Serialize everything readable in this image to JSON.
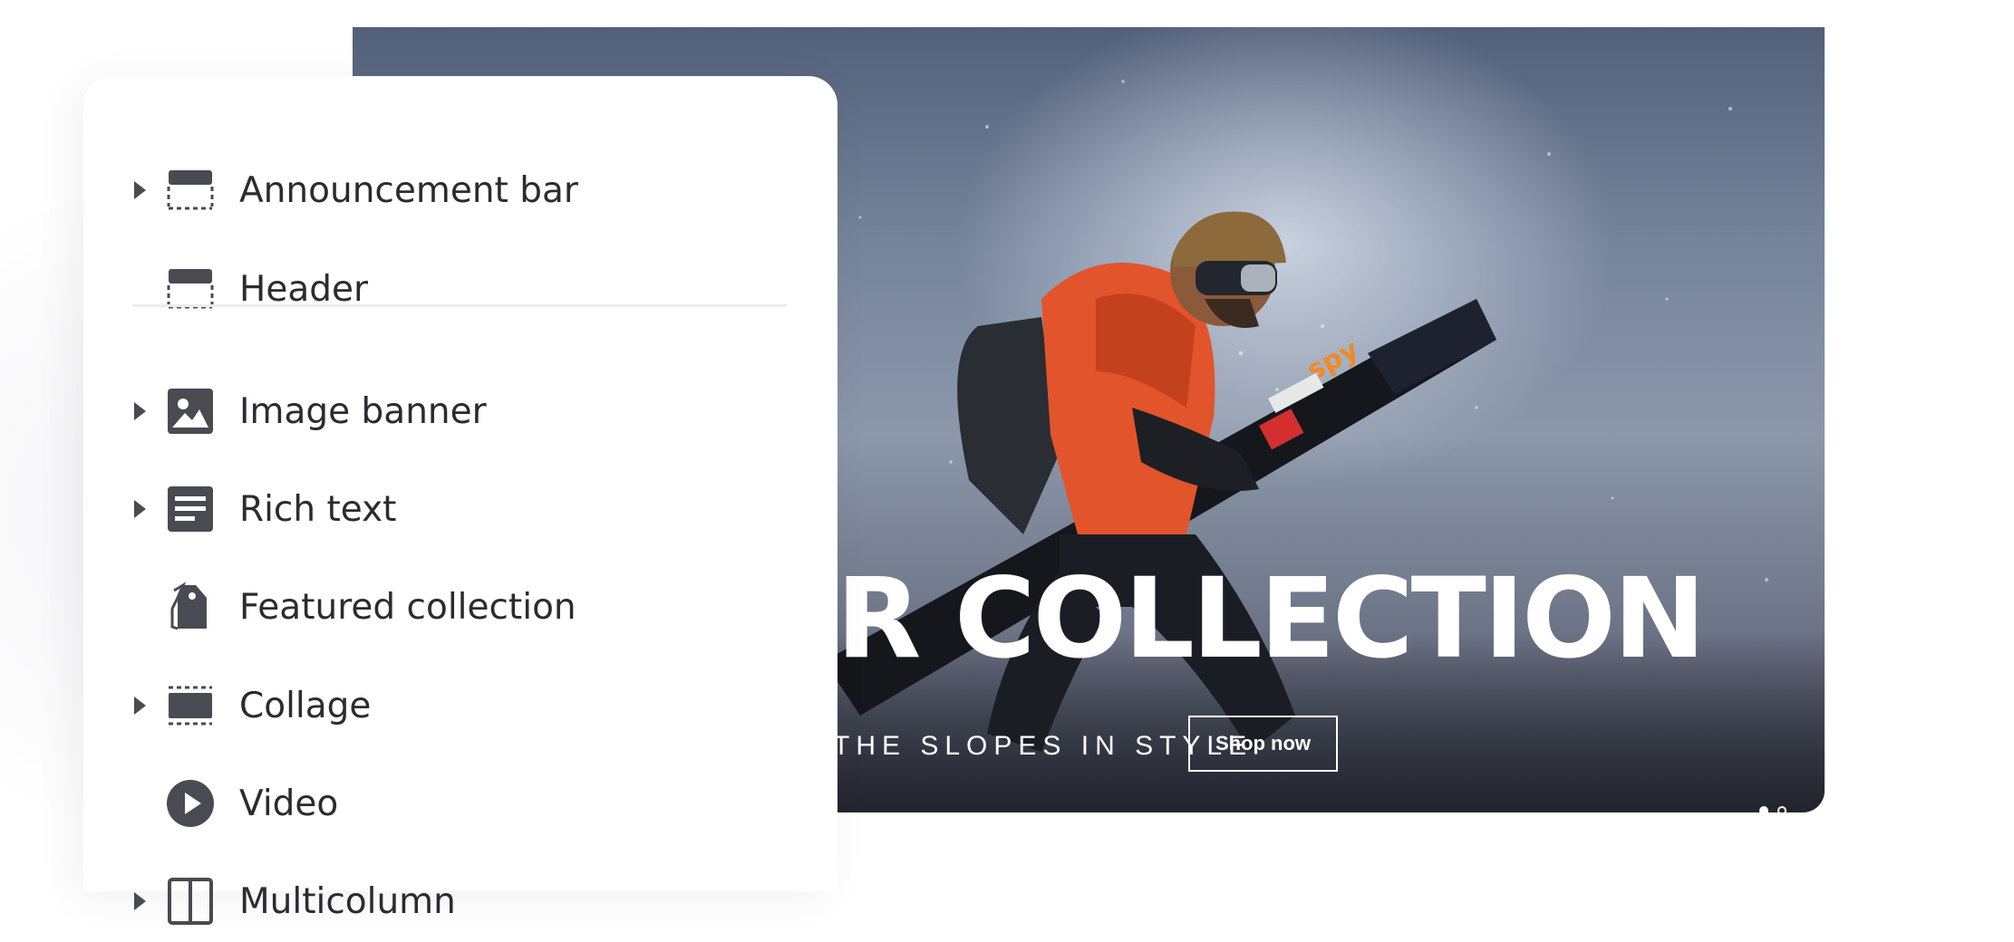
{
  "hero": {
    "title": "NTER COLLECTION",
    "subtitle": "THE SLOPES IN STYLE",
    "cta_label": "Shop now",
    "slides_total": 2,
    "slide_active": 1
  },
  "sections_panel": {
    "items": [
      {
        "label": "Announcement bar",
        "icon": "announcement-bar-icon",
        "expandable": true
      },
      {
        "label": "Header",
        "icon": "header-icon",
        "expandable": false
      },
      {
        "label": "Image banner",
        "icon": "image-icon",
        "expandable": true
      },
      {
        "label": "Rich text",
        "icon": "rich-text-icon",
        "expandable": true
      },
      {
        "label": "Featured collection",
        "icon": "tag-icon",
        "expandable": false
      },
      {
        "label": "Collage",
        "icon": "collage-icon",
        "expandable": true
      },
      {
        "label": "Video",
        "icon": "play-icon",
        "expandable": false
      },
      {
        "label": "Multicolumn",
        "icon": "multicolumn-icon",
        "expandable": true
      }
    ]
  },
  "colors": {
    "panel_bg": "#ffffff",
    "icon": "#4a4a52",
    "text": "#2b2b31",
    "jacket": "#e2542b",
    "banner_sky": "#76849c"
  }
}
